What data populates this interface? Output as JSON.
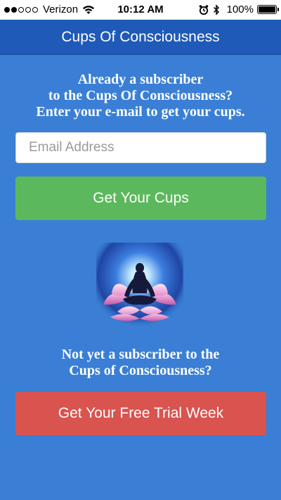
{
  "status_bar": {
    "carrier": "Verizon",
    "signal_bars_filled": 2,
    "signal_bars_total": 5,
    "time": "10:12 AM",
    "battery_percent": "100%",
    "icons": [
      "wifi-icon",
      "alarm-icon",
      "bluetooth-icon",
      "battery-icon"
    ]
  },
  "nav": {
    "title": "Cups Of Consciousness"
  },
  "subscriber_section": {
    "heading_line1": "Already a subscriber",
    "heading_line2": "to the Cups Of Consciousness?",
    "heading_line3": "Enter your e-mail to get your cups.",
    "email_placeholder": "Email Address",
    "email_value": "",
    "submit_label": "Get Your Cups"
  },
  "image": {
    "name": "meditation-lotus-image"
  },
  "trial_section": {
    "heading_line1": "Not yet a subscriber to the",
    "heading_line2": "Cups of Consciousness?",
    "trial_label": "Get Your Free Trial Week"
  },
  "colors": {
    "background": "#3a7fd5",
    "nav_bar": "#1f5ab8",
    "green_button": "#5cb85c",
    "red_button": "#d9534f"
  }
}
